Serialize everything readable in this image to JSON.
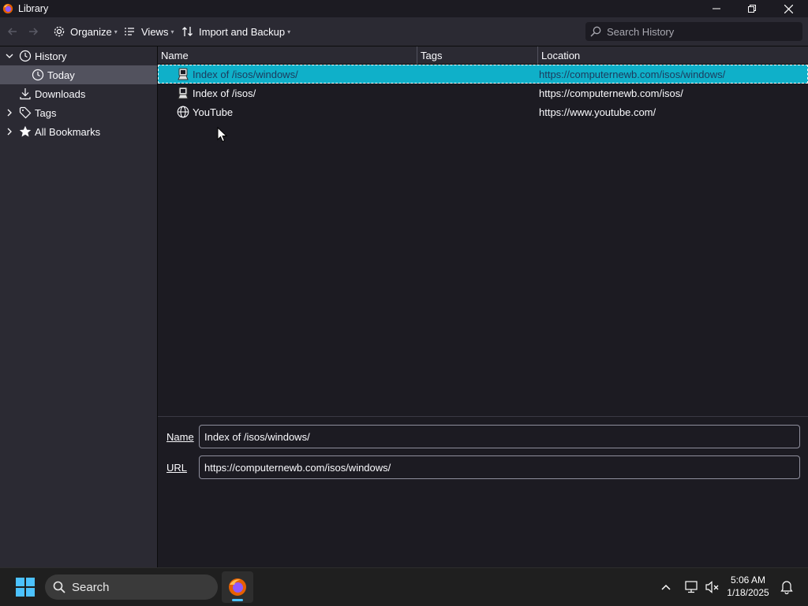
{
  "window": {
    "title": "Library",
    "app_icon": "firefox-icon",
    "controls": [
      "minimize-icon",
      "restore-icon",
      "close-icon"
    ]
  },
  "toolbar": {
    "organize_label": "Organize",
    "views_label": "Views",
    "import_backup_label": "Import and Backup",
    "search_placeholder": "Search History"
  },
  "sidebar": {
    "items": [
      {
        "label": "History",
        "icon": "clock-icon",
        "expanded": true
      },
      {
        "label": "Today",
        "icon": "clock-icon",
        "selected": true
      },
      {
        "label": "Downloads",
        "icon": "download-icon"
      },
      {
        "label": "Tags",
        "icon": "tag-icon",
        "expanded": false
      },
      {
        "label": "All Bookmarks",
        "icon": "star-icon",
        "expanded": false
      }
    ]
  },
  "table": {
    "columns": [
      "Name",
      "Tags",
      "Location"
    ],
    "rows": [
      {
        "name": "Index of /isos/windows/",
        "tags": "",
        "location": "https://computernewb.com/isos/windows/",
        "icon": "site-favicon",
        "selected": true
      },
      {
        "name": "Index of /isos/",
        "tags": "",
        "location": "https://computernewb.com/isos/",
        "icon": "site-favicon"
      },
      {
        "name": "YouTube",
        "tags": "",
        "location": "https://www.youtube.com/",
        "icon": "globe-icon"
      }
    ]
  },
  "details": {
    "name_label": "Name",
    "name_value": "Index of /isos/windows/",
    "url_label": "URL",
    "url_value": "https://computernewb.com/isos/windows/"
  },
  "taskbar": {
    "search_label": "Search",
    "time": "5:06 AM",
    "date": "1/18/2025"
  },
  "colors": {
    "selection": "#0fb0c9",
    "panel": "#2b2a33",
    "background": "#1c1b22"
  }
}
